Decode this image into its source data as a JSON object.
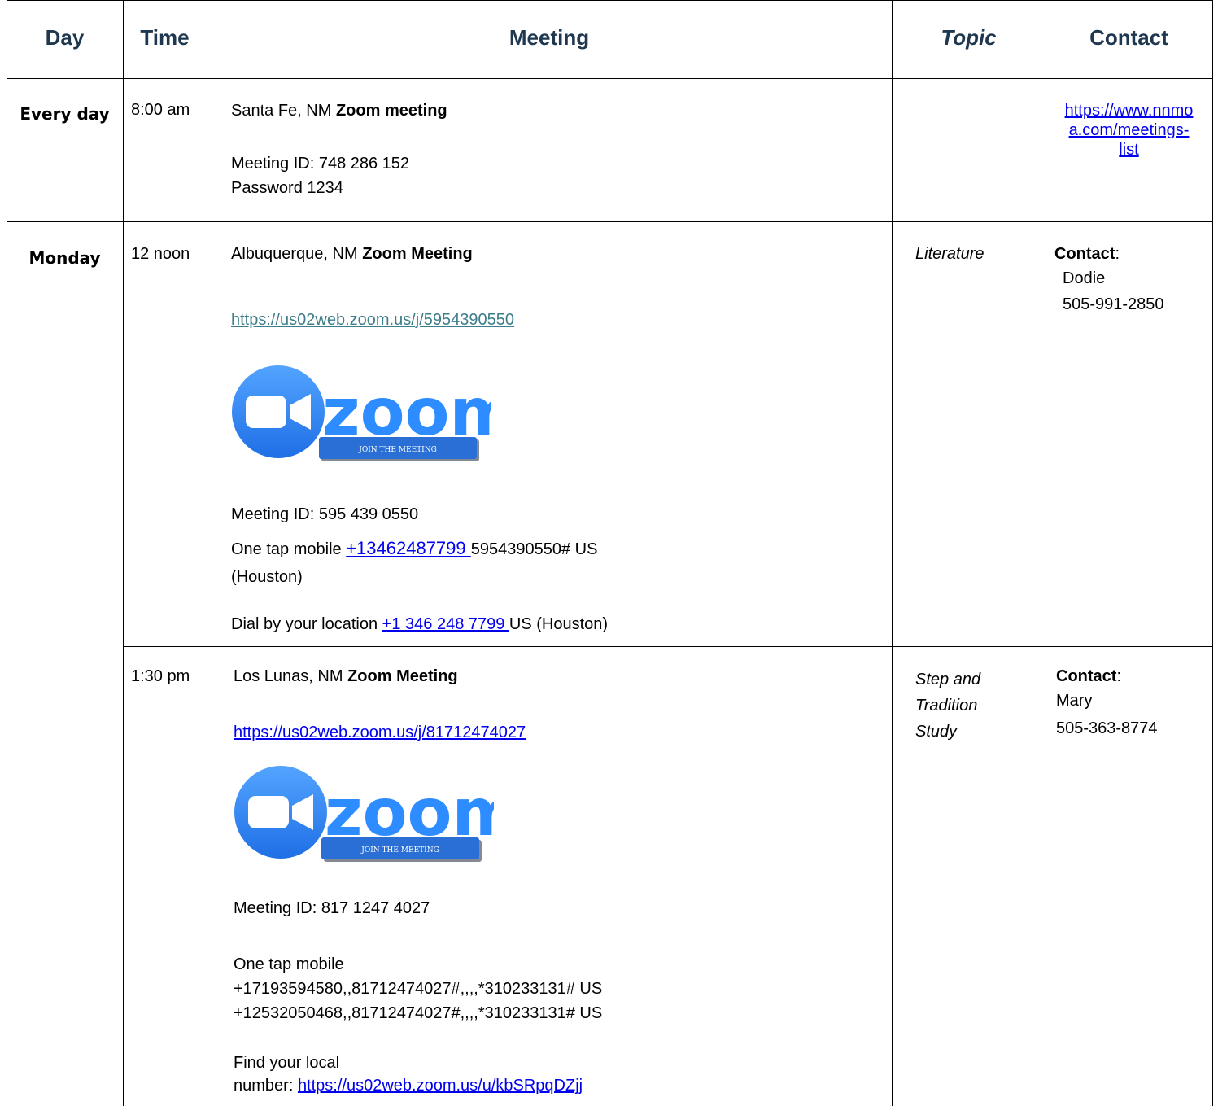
{
  "headers": {
    "day": "Day",
    "time": "Time",
    "meeting": "Meeting",
    "topic": "Topic",
    "contact": "Contact"
  },
  "rows": [
    {
      "day": "Every day",
      "time": "8:00 am",
      "location": "Santa Fe, NM",
      "type": "Zoom meeting",
      "meeting_id": "Meeting ID: 748 286 152",
      "password": "Password 1234",
      "topic": "",
      "contact_link_lines": [
        "https://www.nnmo",
        "a.com/meetings-",
        "list"
      ]
    },
    {
      "day": "Monday",
      "time": "12 noon",
      "location": "Albuquerque, NM",
      "type": "Zoom Meeting",
      "link": "https://us02web.zoom.us/j/5954390550",
      "zoom_word": "zoom",
      "join_label": "JOIN THE MEETING",
      "meeting_id": "Meeting ID: 595 439 0550",
      "one_tap_prefix": "One tap mobile ",
      "one_tap_number": "+13462487799 ",
      "one_tap_suffix": "5954390550# US",
      "one_tap_line2": "(Houston)",
      "dial_prefix": "Dial by your location ",
      "dial_number": "+1 346 248 7799 ",
      "dial_suffix": "US (Houston)",
      "topic": "Literature",
      "contact_label": "Contact",
      "contact_colon": ":",
      "contact_name": "Dodie",
      "contact_phone": "505-991-2850"
    },
    {
      "time": "1:30 pm",
      "location": "Los Lunas, NM",
      "type": "Zoom Meeting",
      "link": "https://us02web.zoom.us/j/81712474027",
      "zoom_word": "zoom",
      "join_label": "JOIN THE MEETING",
      "meeting_id": "Meeting ID: 817 1247 4027",
      "one_tap_label": "One tap mobile",
      "one_tap_line1": "+17193594580,,81712474027#,,,,*310233131# US",
      "one_tap_line2": "+12532050468,,81712474027#,,,,*310233131# US",
      "find_line1": "Find your local",
      "find_prefix": "number: ",
      "find_link": "https://us02web.zoom.us/u/kbSRpqDZjj",
      "topic_lines": [
        "Step and",
        "Tradition",
        "Study"
      ],
      "contact_label": "Contact",
      "contact_colon": ":",
      "contact_name": "Mary",
      "contact_phone": "505-363-8774"
    }
  ],
  "colors": {
    "header_text": "#1f3850",
    "link": "#0000ee",
    "teal_link": "#3d7d8c",
    "zoom_blue": "#2d8cff",
    "button_blue": "#2a6fd6"
  }
}
